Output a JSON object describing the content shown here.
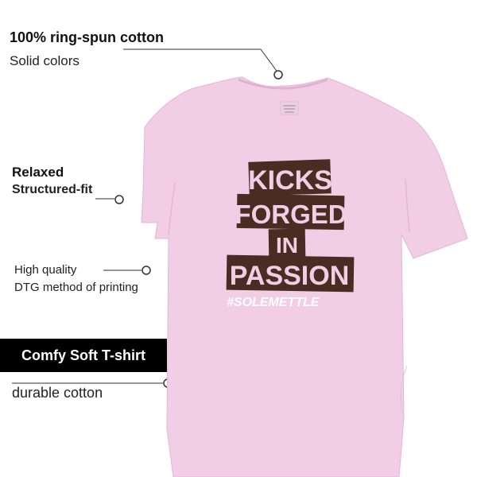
{
  "features": {
    "cotton_title": "100% ring-spun cotton",
    "cotton_sub": "Solid colors",
    "fit_title": "Relaxed",
    "fit_sub": "Structured-fit",
    "quality_line1": "High quality",
    "quality_line2": "DTG method of printing",
    "badge_label": "Comfy Soft T-shirt",
    "durable_label": "durable cotton"
  },
  "shirt": {
    "color": "#f2cde6",
    "print": {
      "line1": "KICKS",
      "line2": "FORGED",
      "line3": "IN",
      "line4": "PASSION",
      "hashtag": "#SOLEMETTLE",
      "block_color": "#4a2d22",
      "text_color": "#f2cde6",
      "hashtag_color": "#ffffff"
    }
  }
}
